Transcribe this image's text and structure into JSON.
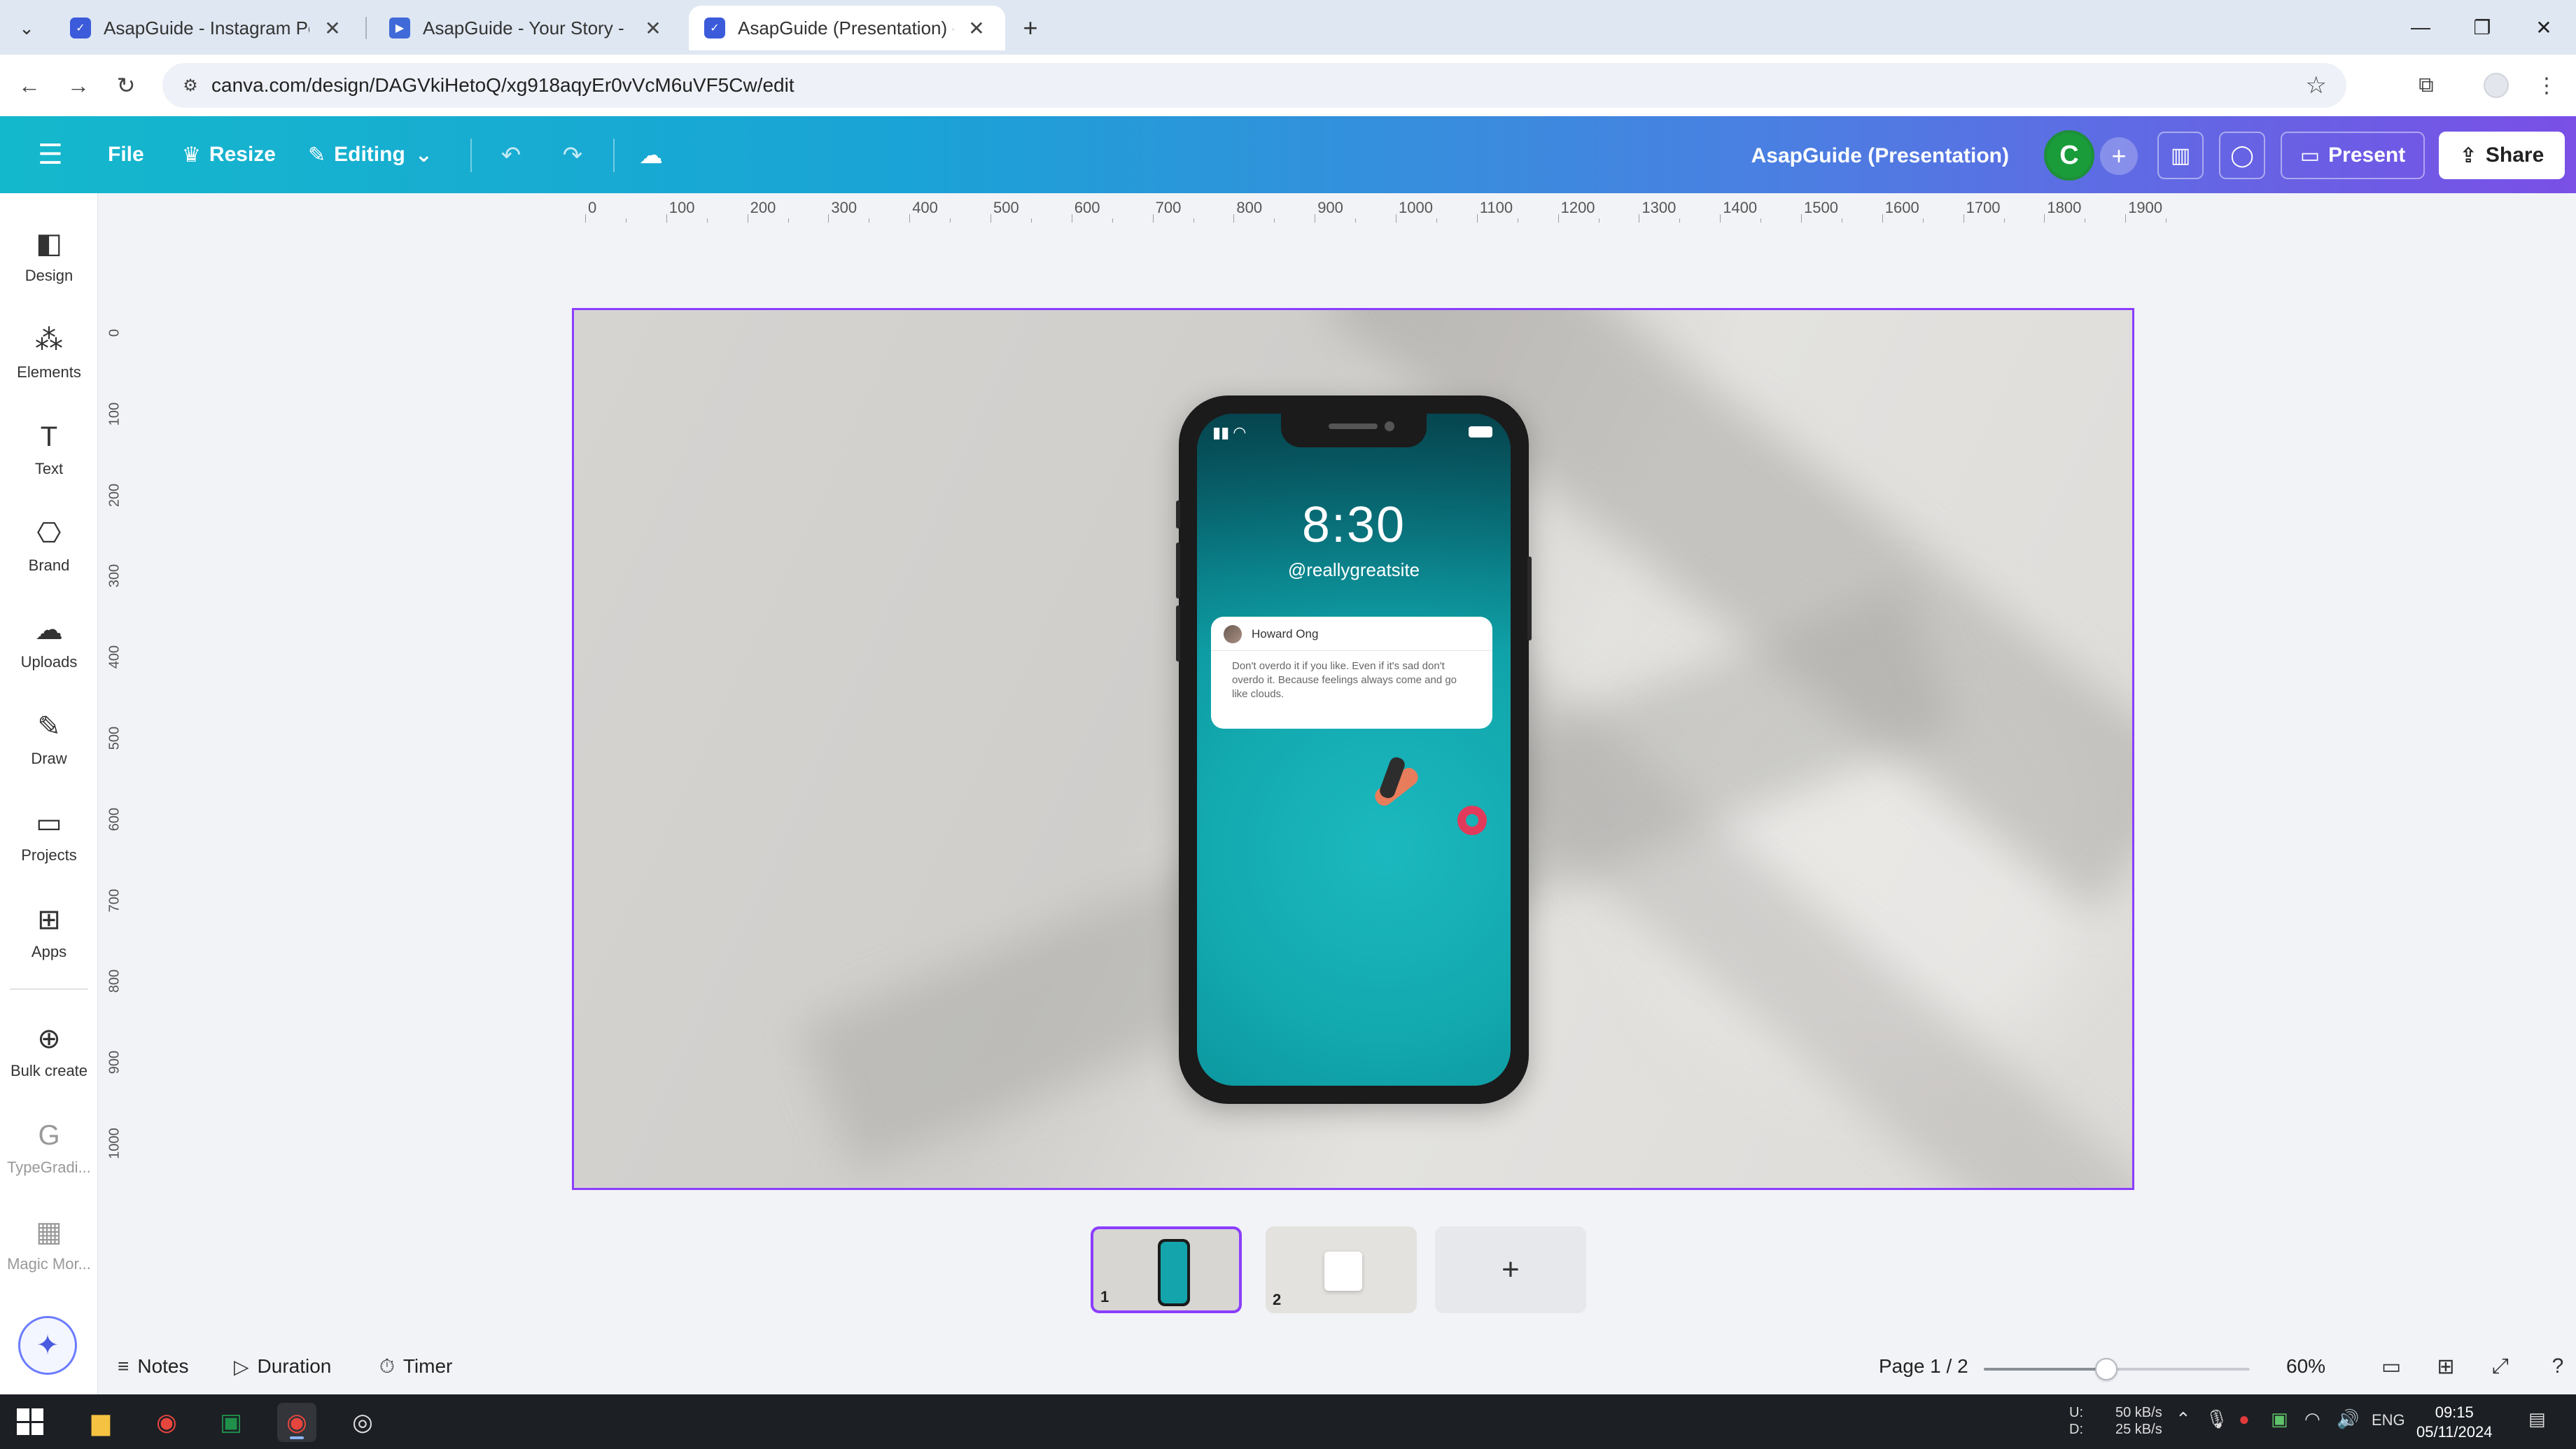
{
  "browser": {
    "tabs": [
      {
        "title": "AsapGuide - Instagram Post",
        "active": false
      },
      {
        "title": "AsapGuide - Your Story - Canva",
        "active": false
      },
      {
        "title": "AsapGuide (Presentation) - Pre",
        "active": true
      }
    ],
    "url": "canva.com/design/DAGVkiHetoQ/xg918aqyEr0vVcM6uVF5Cw/edit"
  },
  "header": {
    "file_label": "File",
    "resize_label": "Resize",
    "editing_label": "Editing",
    "doc_title": "AsapGuide (Presentation)",
    "avatar_initial": "C",
    "present_label": "Present",
    "share_label": "Share"
  },
  "sidebar": {
    "items": [
      {
        "label": "Design"
      },
      {
        "label": "Elements"
      },
      {
        "label": "Text"
      },
      {
        "label": "Brand"
      },
      {
        "label": "Uploads"
      },
      {
        "label": "Draw"
      },
      {
        "label": "Projects"
      },
      {
        "label": "Apps"
      },
      {
        "label": "Bulk create"
      },
      {
        "label": "TypeGradi..."
      },
      {
        "label": "Magic Mor..."
      }
    ]
  },
  "ruler": {
    "top": [
      "0",
      "100",
      "200",
      "300",
      "400",
      "500",
      "600",
      "700",
      "800",
      "900",
      "1000",
      "1100",
      "1200",
      "1300",
      "1400",
      "1500",
      "1600",
      "1700",
      "1800",
      "1900"
    ],
    "left": [
      "0",
      "100",
      "200",
      "300",
      "400",
      "500",
      "600",
      "700",
      "800",
      "900",
      "1000"
    ]
  },
  "phone": {
    "time": "8:30",
    "handle": "@reallygreatsite",
    "notification": {
      "name": "Howard Ong",
      "message": "Don't overdo it if you like. Even if it's sad don't overdo it. Because feelings always come and go like clouds."
    }
  },
  "pages": {
    "thumbs": [
      {
        "num": "1"
      },
      {
        "num": "2"
      }
    ],
    "add_label": "+"
  },
  "footer": {
    "notes_label": "Notes",
    "duration_label": "Duration",
    "timer_label": "Timer",
    "page_indicator": "Page 1 / 2",
    "zoom": "60%",
    "zoom_fraction": 0.46
  },
  "taskbar": {
    "net_labels": "U:\nD:",
    "net_up": "50 kB/s",
    "net_down": "25 kB/s",
    "lang": "ENG",
    "time": "09:15",
    "date": "05/11/2024"
  },
  "colors": {
    "accent": "#8b3dff",
    "header_start": "#14b8cc",
    "header_end": "#7a4fe6",
    "avatar": "#1a9c3a"
  }
}
